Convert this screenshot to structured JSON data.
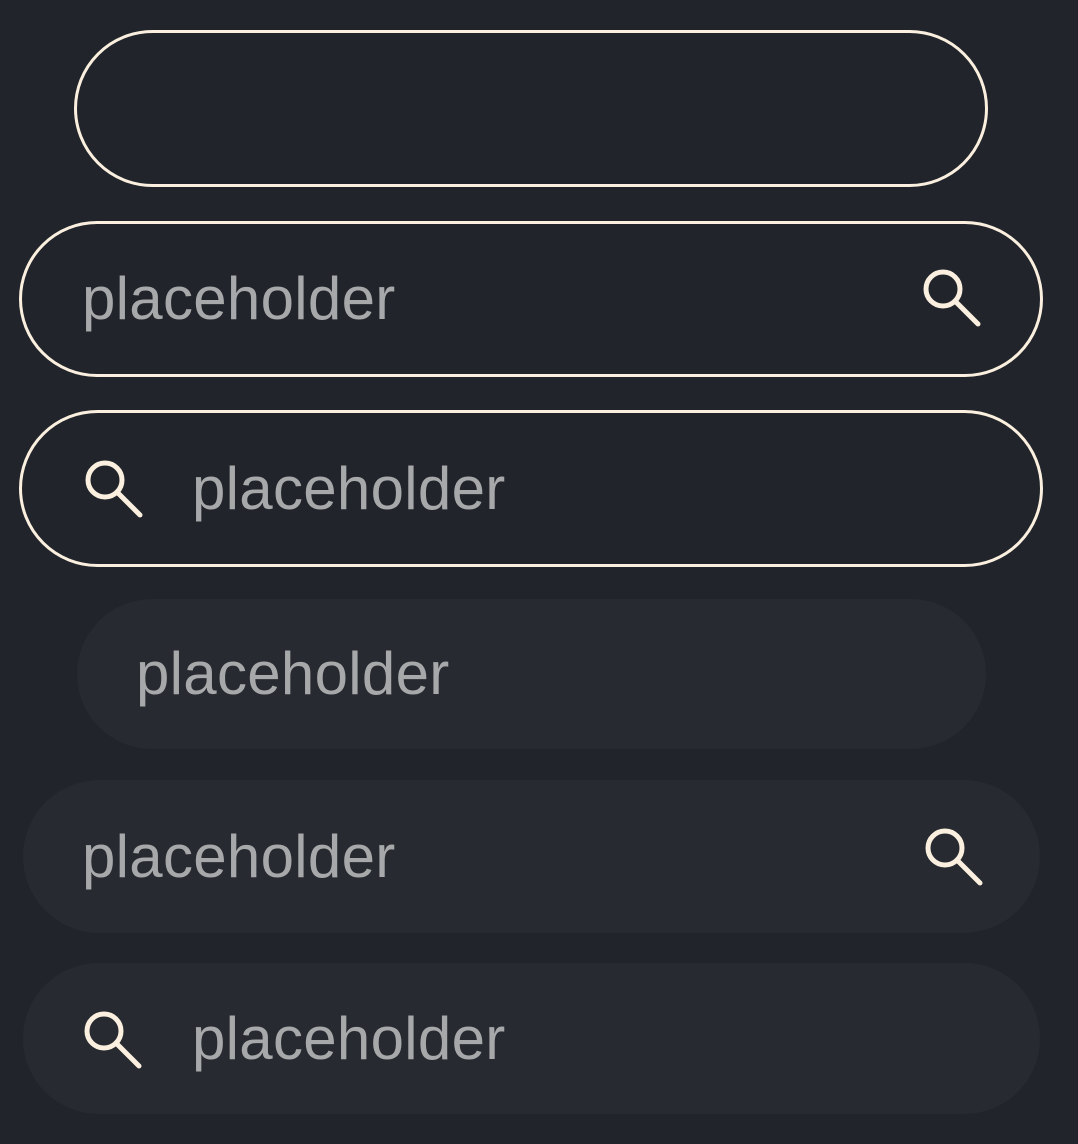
{
  "colors": {
    "background": "#21252b",
    "outline": "#fbf0df",
    "filled_surface": "#272a30",
    "placeholder_text": "#a7a8aa",
    "icon": "#fbf0df"
  },
  "fields": [
    {
      "variant": "outlined",
      "placeholder": "",
      "icon": null
    },
    {
      "variant": "outlined",
      "placeholder": "placeholder",
      "icon": "search-icon",
      "icon_position": "trailing"
    },
    {
      "variant": "outlined",
      "placeholder": "placeholder",
      "icon": "search-icon",
      "icon_position": "leading"
    },
    {
      "variant": "filled",
      "placeholder": "placeholder",
      "icon": null
    },
    {
      "variant": "filled",
      "placeholder": "placeholder",
      "icon": "search-icon",
      "icon_position": "trailing"
    },
    {
      "variant": "filled",
      "placeholder": "placeholder",
      "icon": "search-icon",
      "icon_position": "leading"
    }
  ]
}
